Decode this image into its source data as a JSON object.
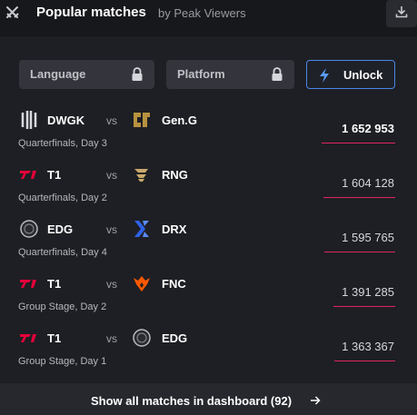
{
  "header": {
    "title": "Popular matches",
    "subtitle": "by Peak Viewers",
    "left_icon": "crossed-swords-icon",
    "download_icon": "download-icon"
  },
  "filters": {
    "language": {
      "label": "Language",
      "icon": "lock-icon"
    },
    "platform": {
      "label": "Platform",
      "icon": "lock-icon"
    },
    "unlock": {
      "label": "Unlock",
      "icon": "lightning-icon",
      "accent": "#4a86e8"
    }
  },
  "matches": [
    {
      "team1": "DWGK",
      "team2": "Gen.G",
      "vs": "vs",
      "stage": "Quarterfinals, Day 3",
      "viewers": "1 652 953",
      "bar_fraction": 1.0
    },
    {
      "team1": "T1",
      "team2": "RNG",
      "vs": "vs",
      "stage": "Quarterfinals, Day 2",
      "viewers": "1 604 128",
      "bar_fraction": 0.97
    },
    {
      "team1": "EDG",
      "team2": "DRX",
      "vs": "vs",
      "stage": "Quarterfinals, Day 4",
      "viewers": "1 595 765",
      "bar_fraction": 0.965
    },
    {
      "team1": "T1",
      "team2": "FNC",
      "vs": "vs",
      "stage": "Group Stage, Day 2",
      "viewers": "1 391 285",
      "bar_fraction": 0.84
    },
    {
      "team1": "T1",
      "team2": "EDG",
      "vs": "vs",
      "stage": "Group Stage, Day 1",
      "viewers": "1 363 367",
      "bar_fraction": 0.825
    }
  ],
  "footer": {
    "label": "Show all matches in dashboard (92)",
    "icon": "arrow-right-icon"
  },
  "colors": {
    "bar": "#e0245e",
    "background": "#1e1f24",
    "accent": "#4a86e8"
  }
}
